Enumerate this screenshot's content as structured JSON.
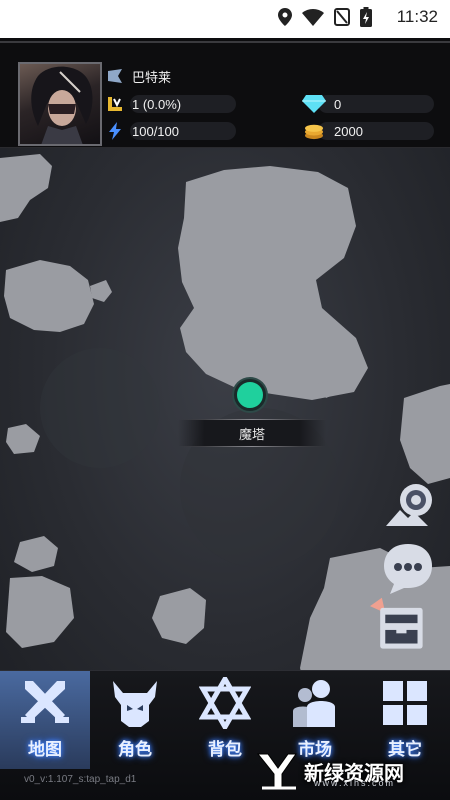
{
  "status_bar": {
    "time": "11:32"
  },
  "player": {
    "name": "巴特莱",
    "level": "1 (0.0%)",
    "energy": "100/100",
    "diamonds": "0",
    "gold": "2000"
  },
  "map": {
    "location_label": "魔塔"
  },
  "nav": {
    "items": [
      {
        "label": "地图"
      },
      {
        "label": "角色"
      },
      {
        "label": "背包"
      },
      {
        "label": "市场"
      },
      {
        "label": "其它"
      }
    ],
    "active_index": 0
  },
  "version": "v0_v:1.107_s:tap_tap_d1",
  "watermark": {
    "text": "新绿资源网",
    "url": "www.xlhs.com"
  },
  "colors": {
    "marker": "#1fd09d",
    "nav_active": "#4a6aa0",
    "nav_glow": "#4a8cff"
  }
}
